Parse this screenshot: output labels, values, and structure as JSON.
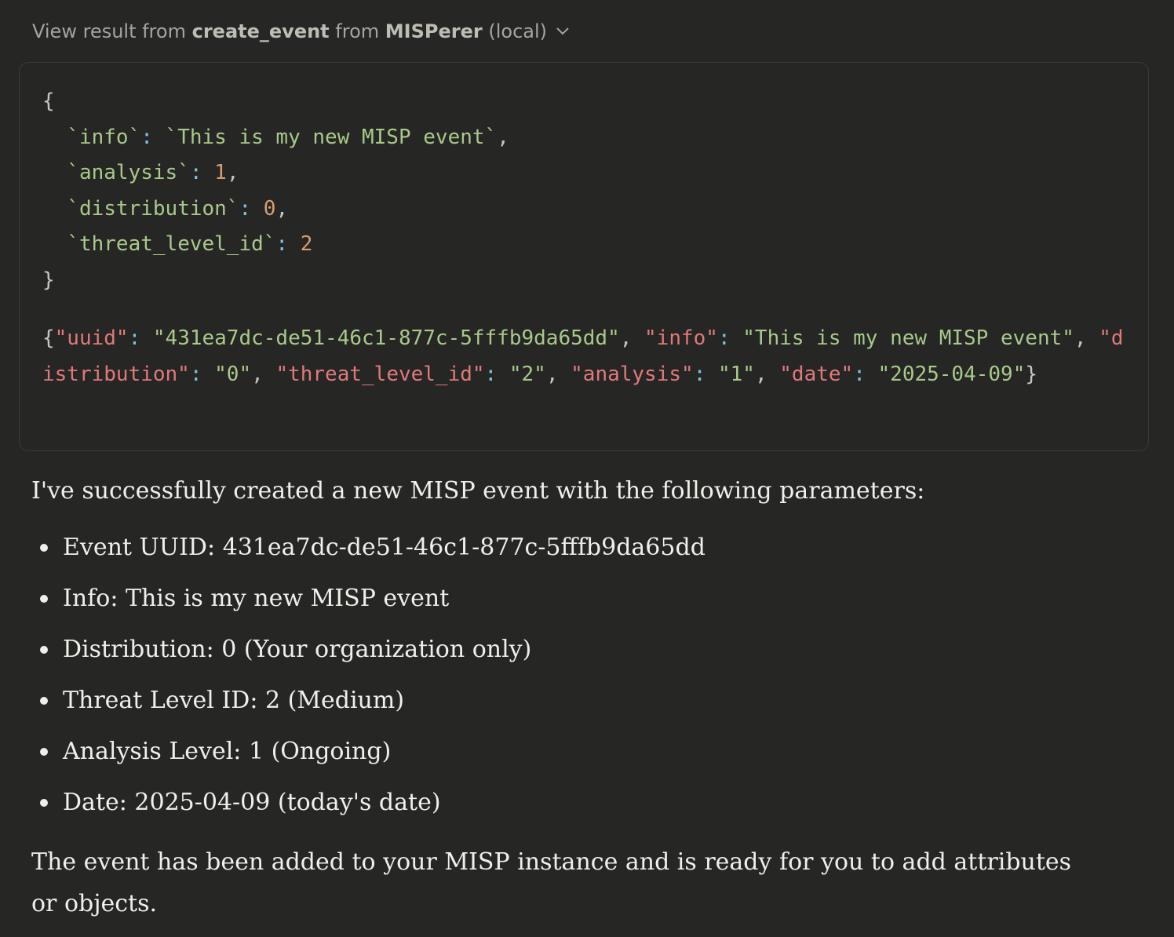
{
  "header": {
    "prefix": "View result from",
    "tool": "create_event",
    "mid": "from",
    "server": "MISPerer",
    "suffix": "(local)",
    "chevron_icon": "chevron-down-icon"
  },
  "params_code": {
    "open": "{",
    "close": "}",
    "lines": [
      {
        "key": "`info`",
        "value": "`This is my new MISP event`",
        "trail": ","
      },
      {
        "key": "`analysis`",
        "value": "1",
        "trail": ","
      },
      {
        "key": "`distribution`",
        "value": "0",
        "trail": ","
      },
      {
        "key": "`threat_level_id`",
        "value": "2",
        "trail": ""
      }
    ]
  },
  "result_code": {
    "pairs": [
      {
        "key": "\"uuid\"",
        "value": "\"431ea7dc-de51-46c1-877c-5fffb9da65dd\""
      },
      {
        "key": "\"info\"",
        "value": "\"This is my new MISP event\""
      },
      {
        "key": "\"distribution\"",
        "value": "\"0\""
      },
      {
        "key": "\"threat_level_id\"",
        "value": "\"2\""
      },
      {
        "key": "\"analysis\"",
        "value": "\"1\""
      },
      {
        "key": "\"date\"",
        "value": "\"2025-04-09\""
      }
    ]
  },
  "response": {
    "intro": "I've successfully created a new MISP event with the following parameters:",
    "bullets": [
      "Event UUID: 431ea7dc-de51-46c1-877c-5fffb9da65dd",
      "Info: This is my new MISP event",
      "Distribution: 0 (Your organization only)",
      "Threat Level ID: 2 (Medium)",
      "Analysis Level: 1 (Ongoing)",
      "Date: 2025-04-09 (today's date)"
    ],
    "outro": "The event has been added to your MISP instance and is ready for you to add attributes or objects."
  },
  "colors": {
    "background": "#262624",
    "text": "#f0efea",
    "code_key": "#a9c98a",
    "code_number": "#d79e6f",
    "result_key": "#e07a7a",
    "result_value": "#a9c98a",
    "code_colon": "#7ec3e0"
  }
}
